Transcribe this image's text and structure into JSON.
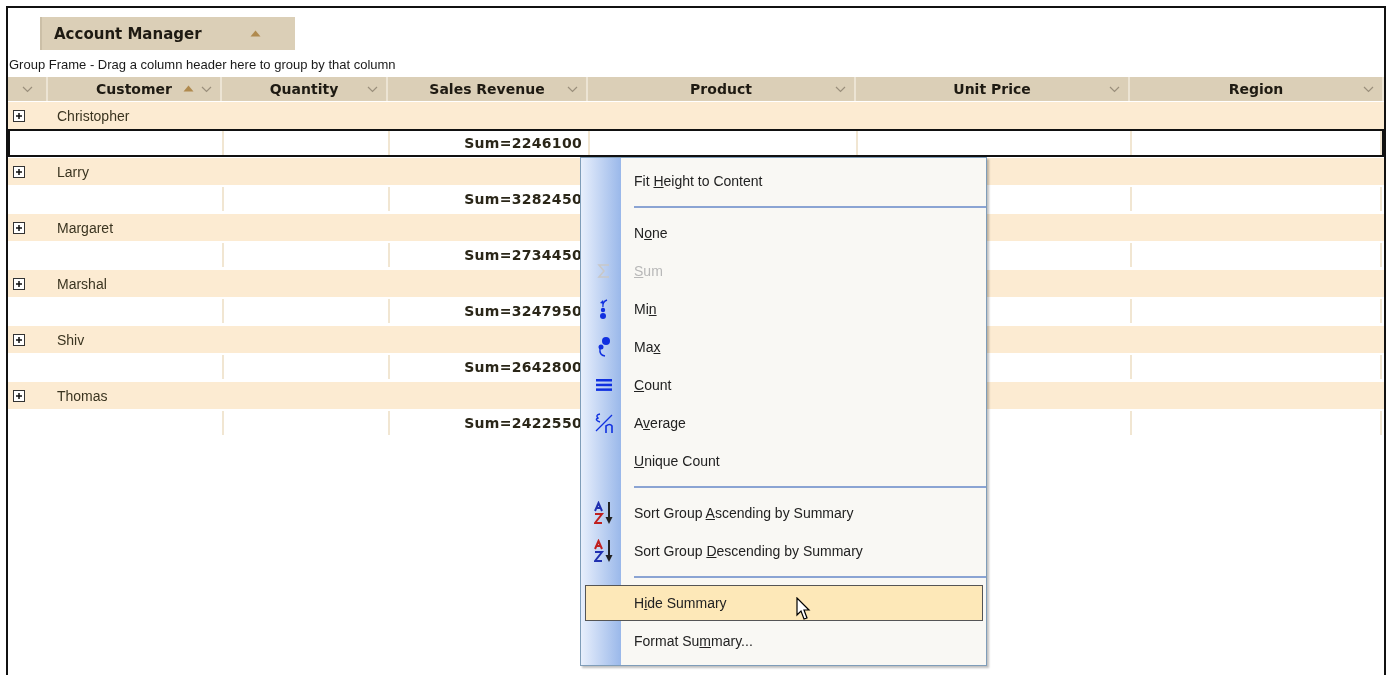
{
  "group_panel": {
    "columns": [
      {
        "label": "Account Manager",
        "sorted_ascending": true
      }
    ],
    "hint": "Group Frame - Drag a column header here to group by that column"
  },
  "columns": [
    {
      "label": "Customer",
      "sorted_ascending": true,
      "has_summary": false
    },
    {
      "label": "Quantity",
      "sorted_ascending": false,
      "has_summary": false
    },
    {
      "label": "Sales Revenue",
      "sorted_ascending": false,
      "has_summary": true
    },
    {
      "label": "Product",
      "sorted_ascending": false,
      "has_summary": false
    },
    {
      "label": "Unit Price",
      "sorted_ascending": false,
      "has_summary": false
    },
    {
      "label": "Region",
      "sorted_ascending": false,
      "has_summary": false
    }
  ],
  "groups": [
    {
      "name": "Christopher",
      "expanded": false,
      "summary": "Sum=2246100",
      "selected": true
    },
    {
      "name": "Larry",
      "expanded": false,
      "summary": "Sum=3282450",
      "selected": false
    },
    {
      "name": "Margaret",
      "expanded": false,
      "summary": "Sum=2734450",
      "selected": false
    },
    {
      "name": "Marshal",
      "expanded": false,
      "summary": "Sum=3247950",
      "selected": false
    },
    {
      "name": "Shiv",
      "expanded": false,
      "summary": "Sum=2642800",
      "selected": false
    },
    {
      "name": "Thomas",
      "expanded": false,
      "summary": "Sum=2422550",
      "selected": false
    }
  ],
  "context_menu": {
    "items": [
      {
        "kind": "plain",
        "before": "Fit ",
        "key": "H",
        "after": "eight to Content",
        "disabled": false,
        "selected": false
      },
      {
        "kind": "separator"
      },
      {
        "kind": "plain",
        "before": "N",
        "key": "o",
        "after": "ne",
        "disabled": false,
        "selected": false
      },
      {
        "kind": "sum",
        "key": "S",
        "after": "um",
        "disabled": true,
        "selected": false
      },
      {
        "kind": "min",
        "before": "Mi",
        "key": "n",
        "disabled": false,
        "selected": false
      },
      {
        "kind": "max",
        "before": "Ma",
        "key": "x",
        "disabled": false,
        "selected": false
      },
      {
        "kind": "count",
        "key": "C",
        "after": "ount",
        "disabled": false,
        "selected": false
      },
      {
        "kind": "average",
        "before": "A",
        "key": "v",
        "after": "erage",
        "disabled": false,
        "selected": false
      },
      {
        "kind": "plain",
        "key": "U",
        "after": "nique Count",
        "disabled": false,
        "selected": false
      },
      {
        "kind": "separator"
      },
      {
        "kind": "sort-ascending",
        "before": "Sort Group ",
        "key": "A",
        "after": "scending by Summary",
        "disabled": false,
        "selected": false
      },
      {
        "kind": "sort-descending",
        "before": "Sort Group ",
        "key": "D",
        "after": "escending by Summary",
        "disabled": false,
        "selected": false
      },
      {
        "kind": "separator"
      },
      {
        "kind": "plain",
        "before": "H",
        "key": "i",
        "after": "de Summary",
        "disabled": false,
        "selected": true
      },
      {
        "kind": "plain",
        "before": "Format Su",
        "key": "m",
        "after": "mary...",
        "disabled": false,
        "selected": false
      }
    ]
  }
}
